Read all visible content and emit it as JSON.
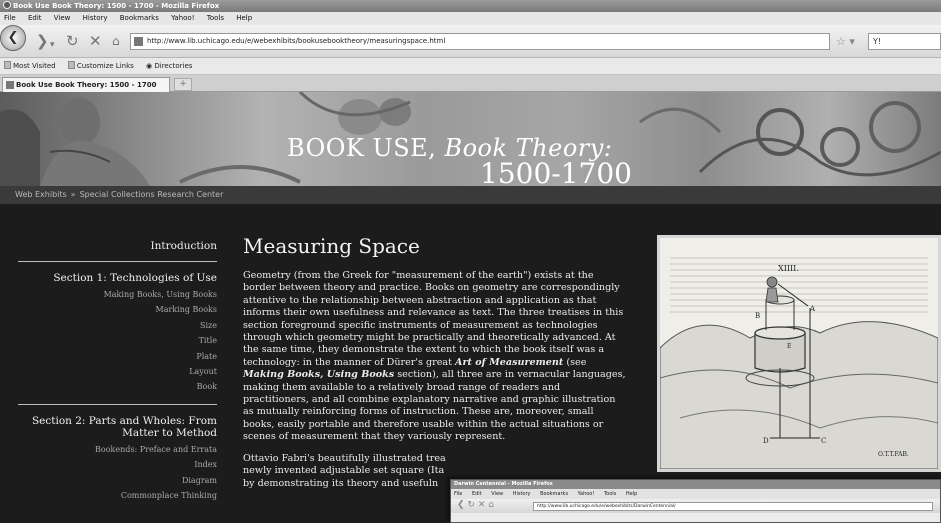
{
  "browser": {
    "window_title": "Book Use Book Theory: 1500 - 1700 - Mozilla Firefox",
    "menu": [
      "File",
      "Edit",
      "View",
      "History",
      "Bookmarks",
      "Yahoo!",
      "Tools",
      "Help"
    ],
    "url": "http://www.lib.uchicago.edu/e/webexhibits/bookusebooktheory/measuringspace.html",
    "search_value": "Y!",
    "bookmarks": [
      "Most Visited",
      "Customize Links",
      "Directories"
    ],
    "active_tab": "Book Use Book Theory: 1500 - 1700",
    "new_tab_label": "+"
  },
  "banner": {
    "line1_main": "BOOK USE, ",
    "line1_italic": "Book Theory:",
    "line2": "1500-1700"
  },
  "breadcrumb": {
    "items": [
      "Web Exhibits",
      "Special Collections Research Center"
    ],
    "separator": "»"
  },
  "sidebar": {
    "intro": "Introduction",
    "section1": {
      "title": "Section 1: Technologies of Use",
      "items": [
        "Making Books, Using Books",
        "Marking Books",
        "Size",
        "Title",
        "Plate",
        "Layout",
        "Book"
      ]
    },
    "section2": {
      "title_line1": "Section 2: Parts and Wholes: From",
      "title_line2": "Matter to Method",
      "items": [
        "Bookends: Preface and Errata",
        "Index",
        "Diagram",
        "Commonplace Thinking"
      ]
    }
  },
  "article": {
    "title": "Measuring Space",
    "p1_part1": "Geometry (from the Greek for \"measurement of the earth\") exists at the border between theory and practice. Books on geometry are correspondingly attentive to the relationship between abstraction and application as that informs their own usefulness and relevance as text. The three treatises in this section foreground specific instruments of measurement as technologies through which geometry might be practically and theoretically advanced. At the same time, they demonstrate the extent to which the book itself was a technology: in the manner of Dürer's great ",
    "p1_em1": "Art of Measurement",
    "p1_part2": " (see ",
    "p1_em2": "Making Books, Using Books",
    "p1_part3": " section), all three are in vernacular languages, making them available to a relatively broad range of readers and practitioners, and all combine explanatory narrative and graphic illustration as mutually reinforcing forms of instruction. These are, moreover, small books, easily portable and therefore usable within the actual situations or scenes of measurement that they variously represent.",
    "p2_line1": "Ottavio Fabri's beautifully illustrated trea",
    "p2_line2": "newly invented adjustable set square (Ita",
    "p2_line3": "by demonstrating its theory and usefuln"
  },
  "figure": {
    "plate_number": "XIIII.",
    "label_a": "A",
    "label_b": "B",
    "label_c": "C",
    "label_d": "D",
    "label_e": "E",
    "signature": "O.T.T.FAB."
  },
  "overlay": {
    "title": "Darwin Centennial - Mozilla Firefox",
    "menu": [
      "File",
      "Edit",
      "View",
      "History",
      "Bookmarks",
      "Yahoo!",
      "Tools",
      "Help"
    ],
    "url": "http://www.lib.uchicago.edu/e/webexhibits/DarwinCentennial/"
  }
}
